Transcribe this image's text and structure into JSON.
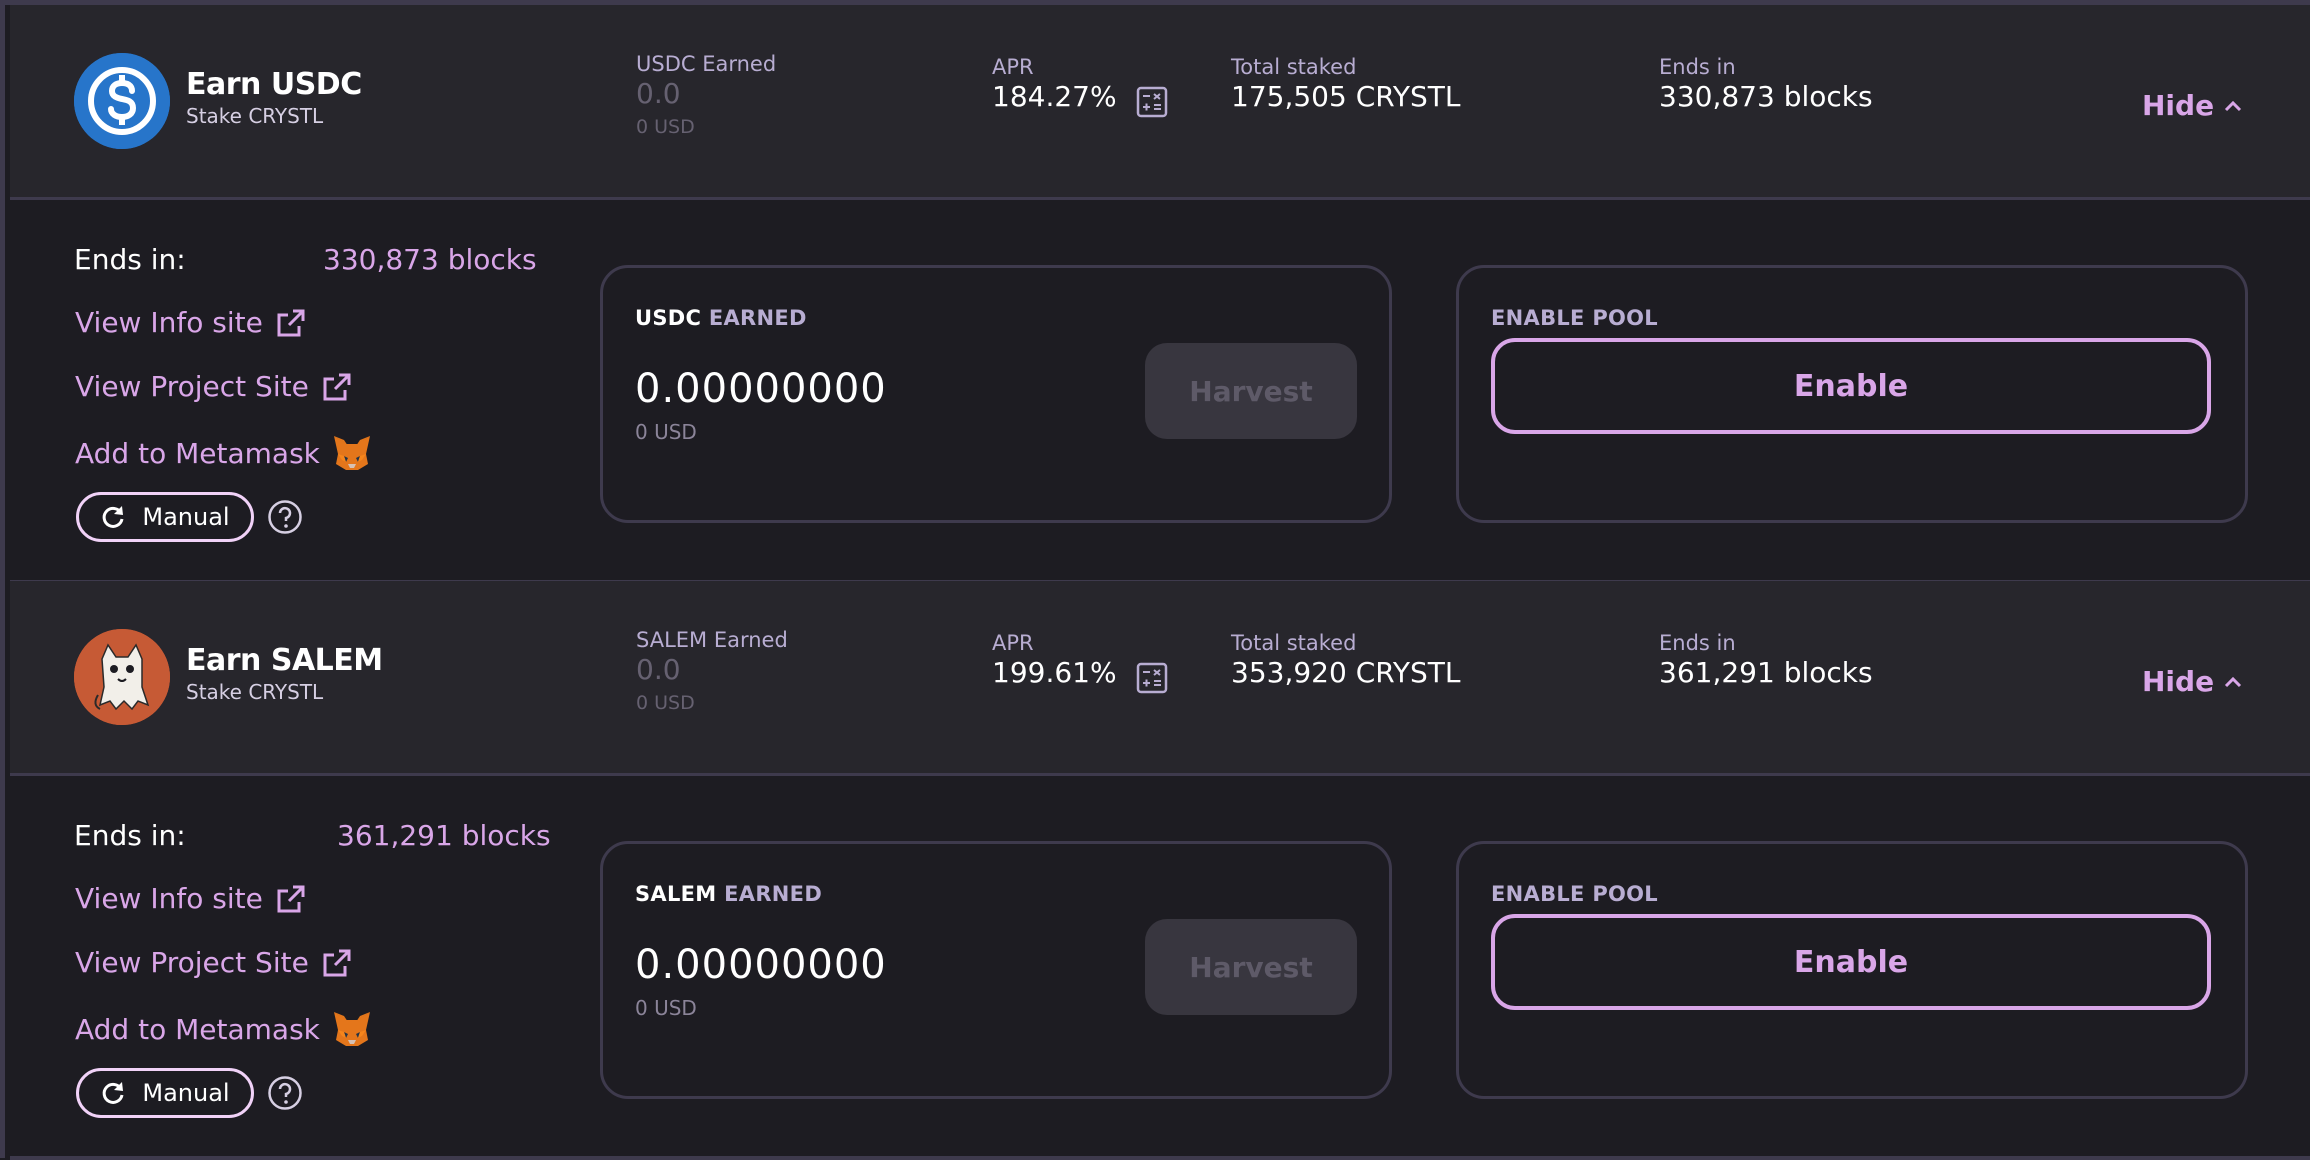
{
  "pools": [
    {
      "title": "Earn USDC",
      "subtitle": "Stake CRYSTL",
      "logo_icon": "usdc-icon",
      "logo_color": "#2775ca",
      "earned_label": "USDC Earned",
      "earned_value": "0.0",
      "earned_usd": "0 USD",
      "apr_label": "APR",
      "apr_value": "184.27%",
      "total_staked_label": "Total staked",
      "total_staked_value": "175,505 CRYSTL",
      "ends_label": "Ends in",
      "ends_value": "330,873 blocks",
      "hide_label": "Hide",
      "details": {
        "ends_in_label": "Ends in:",
        "ends_in_value": "330,873 blocks",
        "view_info": "View Info site",
        "view_project": "View Project Site",
        "add_metamask": "Add to Metamask",
        "manual": "Manual",
        "earned_token": "USDC",
        "earned_suffix": "EARNED",
        "earned_amount": "0.00000000",
        "earned_amount_usd": "0 USD",
        "harvest": "Harvest",
        "enable_pool_label": "ENABLE POOL",
        "enable": "Enable"
      }
    },
    {
      "title": "Earn SALEM",
      "subtitle": "Stake CRYSTL",
      "logo_icon": "salem-cat-icon",
      "logo_color": "#c65a35",
      "earned_label": "SALEM Earned",
      "earned_value": "0.0",
      "earned_usd": "0 USD",
      "apr_label": "APR",
      "apr_value": "199.61%",
      "total_staked_label": "Total staked",
      "total_staked_value": "353,920 CRYSTL",
      "ends_label": "Ends in",
      "ends_value": "361,291 blocks",
      "hide_label": "Hide",
      "details": {
        "ends_in_label": "Ends in:",
        "ends_in_value": "361,291 blocks",
        "view_info": "View Info site",
        "view_project": "View Project Site",
        "add_metamask": "Add to Metamask",
        "manual": "Manual",
        "earned_token": "SALEM",
        "earned_suffix": "EARNED",
        "earned_amount": "0.00000000",
        "earned_amount_usd": "0 USD",
        "harvest": "Harvest",
        "enable_pool_label": "ENABLE POOL",
        "enable": "Enable"
      }
    }
  ],
  "colors": {
    "accent": "#d9a6e8",
    "background": "#1d1c22",
    "header_background": "#27262c",
    "border": "#3e3a4d"
  }
}
